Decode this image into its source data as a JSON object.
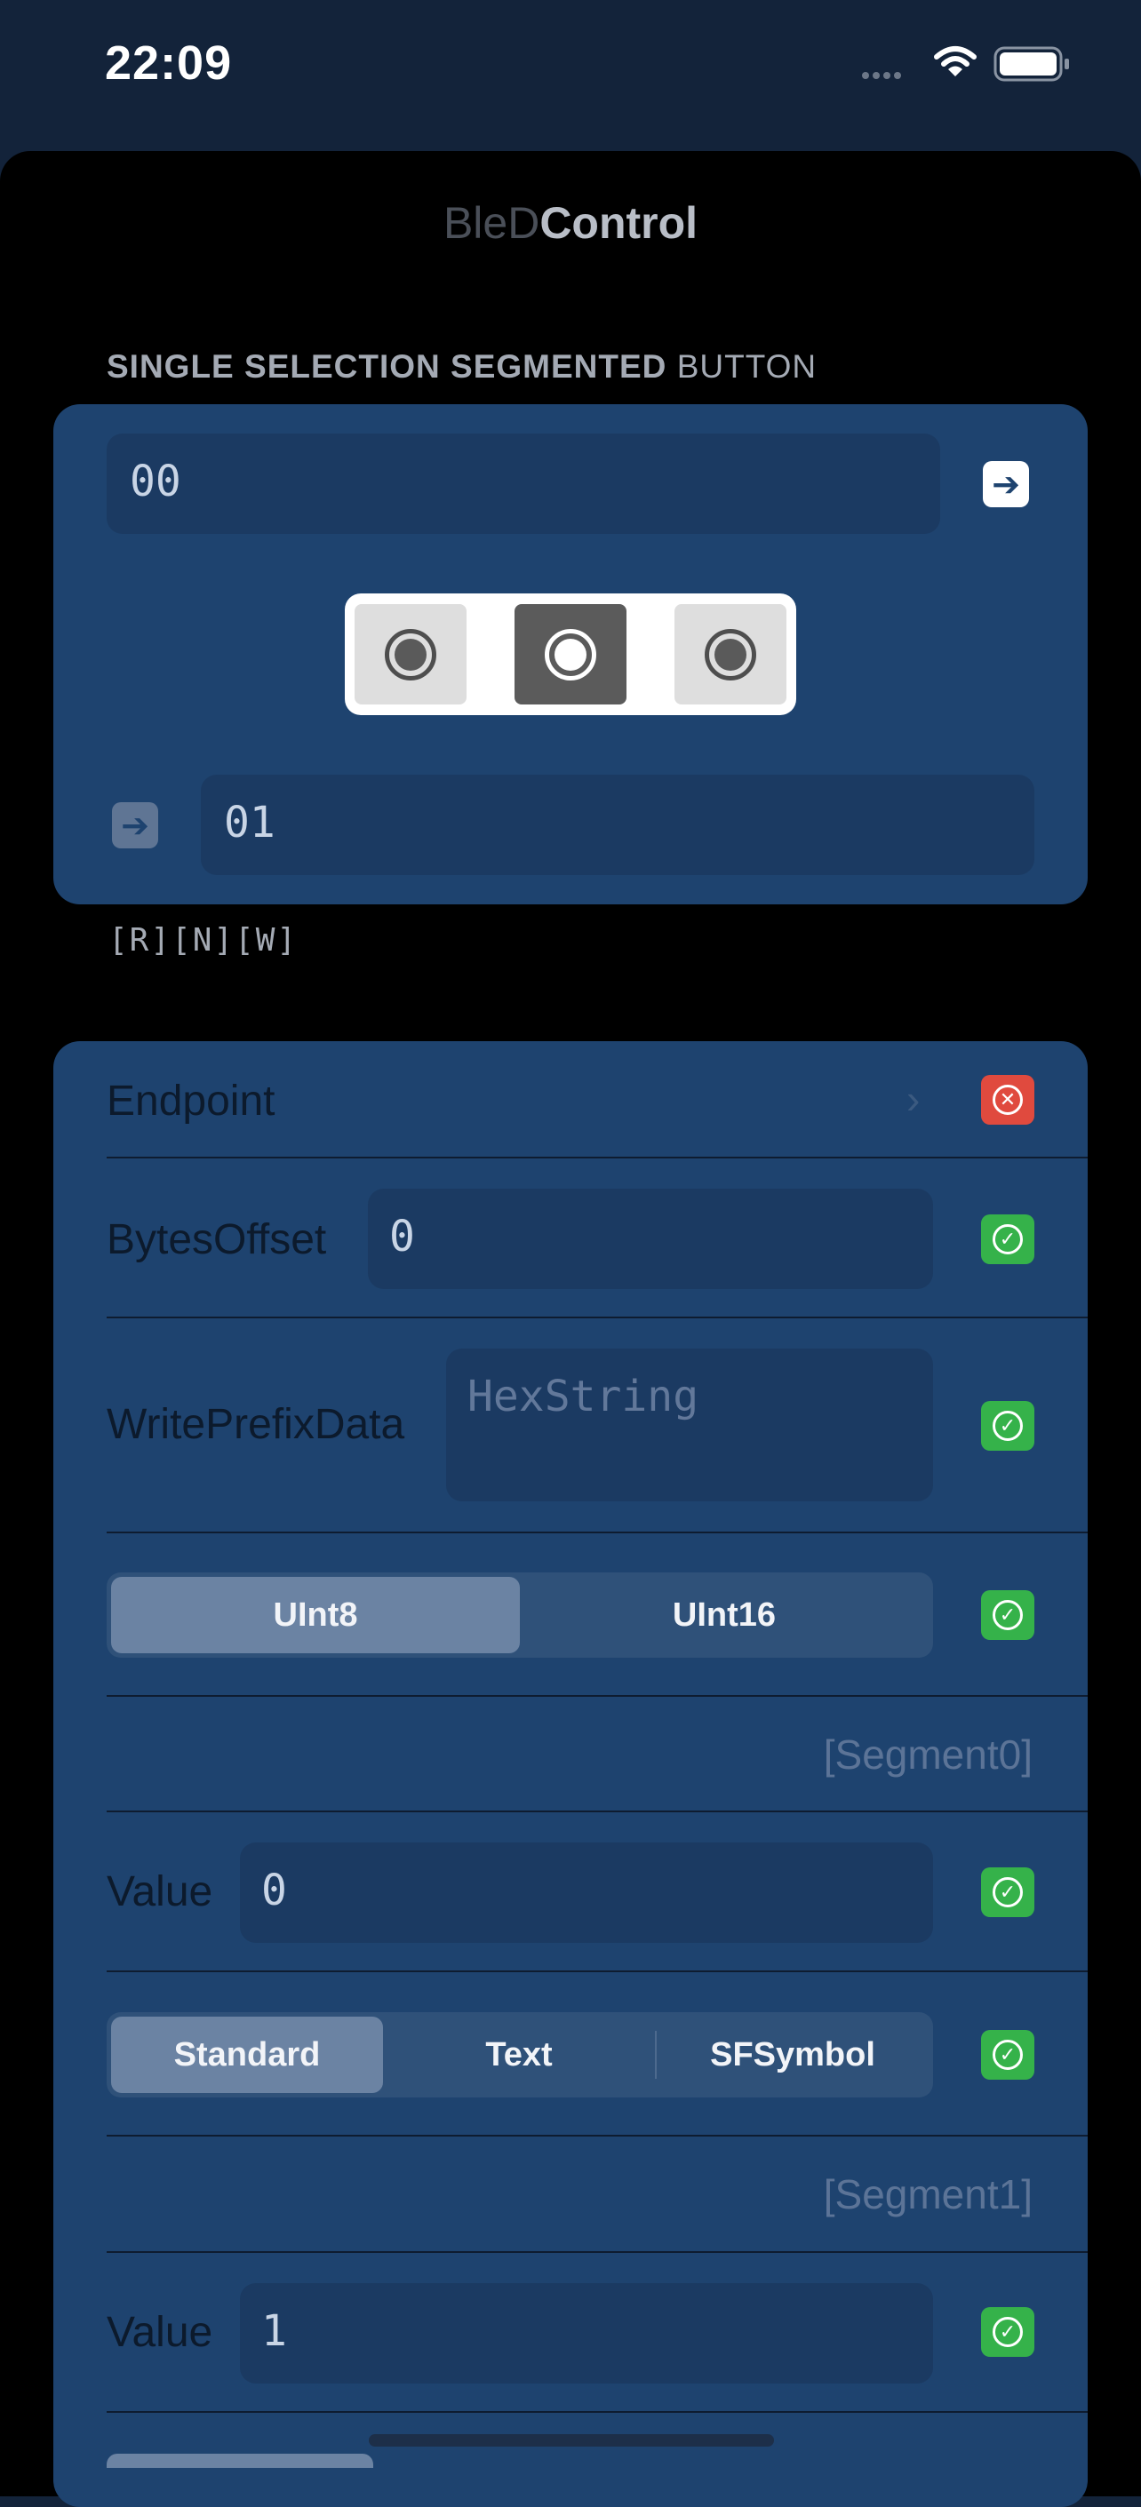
{
  "status_bar": {
    "time": "22:09"
  },
  "app": {
    "title_part1": "BleD",
    "title_part2": "Control"
  },
  "section": {
    "header_bold": "SINGLE SELECTION SEGMENTED",
    "header_regular": "BUTTON"
  },
  "control_card": {
    "write_value": "00",
    "read_value": "01",
    "segments": [
      {
        "icon": "record-circle-icon",
        "selected": false
      },
      {
        "icon": "record-circle-icon",
        "selected": true
      },
      {
        "icon": "record-circle-icon",
        "selected": false
      }
    ]
  },
  "properties": "[R][N][W]",
  "settings": {
    "endpoint_label": "Endpoint",
    "bytes_offset_label": "BytesOffset",
    "bytes_offset_value": "0",
    "write_prefix_label": "WritePrefixData",
    "write_prefix_placeholder": "HexString",
    "int_type_options": [
      "UInt8",
      "UInt16"
    ],
    "int_type_selected": "UInt8",
    "segment0_label": "[Segment0]",
    "value0_label": "Value",
    "value0_value": "0",
    "style0_options": [
      "Standard",
      "Text",
      "SFSymbol"
    ],
    "style0_selected": "Standard",
    "segment1_label": "[Segment1]",
    "value1_label": "Value",
    "value1_value": "1"
  },
  "colors": {
    "card": "#1e436f",
    "ok": "#35b24a",
    "error": "#e04a3e",
    "background": "#13233a"
  }
}
